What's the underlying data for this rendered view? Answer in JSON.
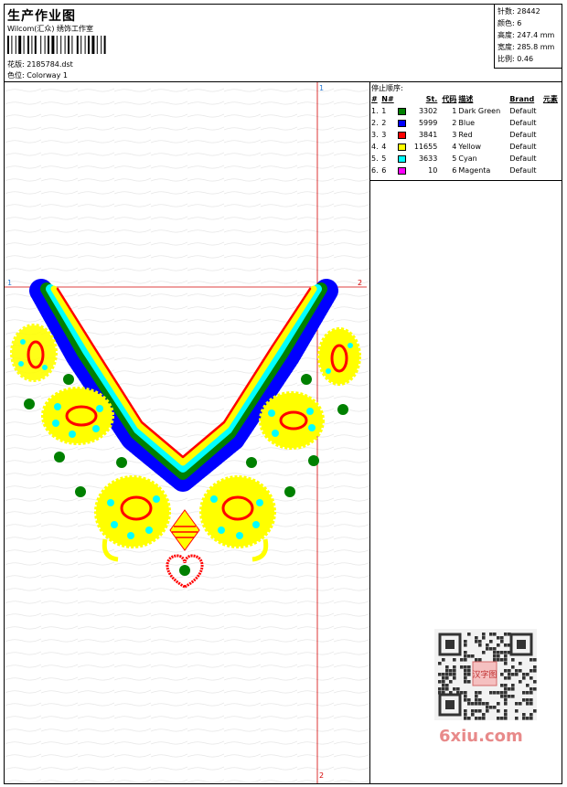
{
  "header": {
    "title": "生产作业图",
    "company": "Wilcom(汇众) 绣饰工作室",
    "design_label": "花版:",
    "design_value": "2185784.dst",
    "colorway_label": "色位:",
    "colorway_value": "Colorway 1"
  },
  "stats": [
    {
      "label": "针数:",
      "value": "28442"
    },
    {
      "label": "颜色:",
      "value": "6"
    },
    {
      "label": "高度:",
      "value": "247.4 mm"
    },
    {
      "label": "宽度:",
      "value": "285.8 mm"
    },
    {
      "label": "比例:",
      "value": "0.46"
    }
  ],
  "stop_sequence": {
    "title": "停止顺序:",
    "columns": [
      "#",
      "N#",
      "St.",
      "代码",
      "描述",
      "Brand",
      "元素"
    ],
    "rows": [
      {
        "index": "1.",
        "n": "1",
        "st": "3302",
        "code": "1",
        "desc": "Dark Green",
        "brand": "Default",
        "color": "#008000"
      },
      {
        "index": "2.",
        "n": "2",
        "st": "5999",
        "code": "2",
        "desc": "Blue",
        "brand": "Default",
        "color": "#0000ff"
      },
      {
        "index": "3.",
        "n": "3",
        "st": "3841",
        "code": "3",
        "desc": "Red",
        "brand": "Default",
        "color": "#ff0000"
      },
      {
        "index": "4.",
        "n": "4",
        "st": "11655",
        "code": "4",
        "desc": "Yellow",
        "brand": "Default",
        "color": "#ffff00"
      },
      {
        "index": "5.",
        "n": "5",
        "st": "3633",
        "code": "5",
        "desc": "Cyan",
        "brand": "Default",
        "color": "#00ffff"
      },
      {
        "index": "6.",
        "n": "6",
        "st": "10",
        "code": "6",
        "desc": "Magenta",
        "brand": "Default",
        "color": "#ff00ff"
      }
    ]
  },
  "guides": {
    "top": "1",
    "bottom": "2",
    "left": "1",
    "right": "2"
  },
  "watermark": "6xiu.com",
  "qr_stamp": "汉字图"
}
